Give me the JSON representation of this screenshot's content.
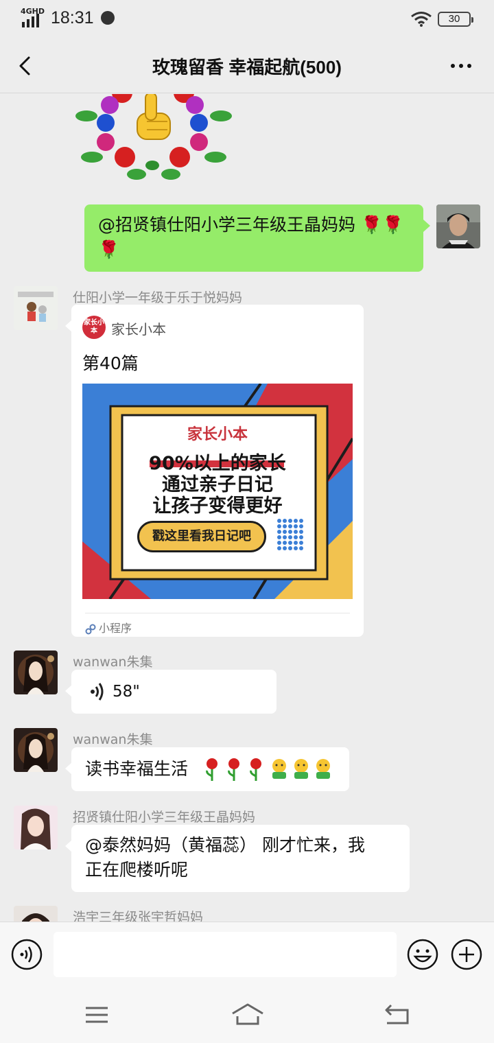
{
  "status_bar": {
    "network": "4GHD",
    "time": "18:31",
    "battery": "30"
  },
  "header": {
    "title": "玫瑰留香  幸福起航(500)"
  },
  "messages": [
    {
      "type": "sticker",
      "sticker": "thumbs-up-rose-wreath"
    },
    {
      "type": "text",
      "side": "right",
      "text": "@招贤镇仕阳小学三年级王晶妈妈 🌹🌹🌹"
    },
    {
      "type": "mini_program",
      "side": "left",
      "sender": "仕阳小学一年级于乐于悦妈妈",
      "source": "家长小本",
      "logo_text": "家长小本",
      "title": "第40篇",
      "poster": {
        "brand": "家长小本",
        "line1": "90%以上的家长",
        "line2": "通过亲子日记",
        "line3": "让孩子变得更好",
        "button": "戳这里看我日记吧"
      },
      "footer": "小程序"
    },
    {
      "type": "voice",
      "side": "left",
      "sender": "wanwan朱集",
      "duration": "58\""
    },
    {
      "type": "text",
      "side": "left",
      "sender": "wanwan朱集",
      "text": "读书幸福生活"
    },
    {
      "type": "text",
      "side": "left",
      "sender": "招贤镇仕阳小学三年级王晶妈妈",
      "line1": "@泰然妈妈（黄福蕊） 刚才忙来，我",
      "line2": "正在爬楼听呢"
    },
    {
      "type": "partial",
      "side": "left",
      "sender": "浩宇三年级张宇哲妈妈"
    }
  ],
  "colors": {
    "background": "#ededed",
    "bubble_self": "#95ec69",
    "bubble_other": "#ffffff",
    "poster_blue": "#3b7fd6",
    "poster_red": "#d2323e",
    "poster_yellow": "#f2c24f"
  }
}
